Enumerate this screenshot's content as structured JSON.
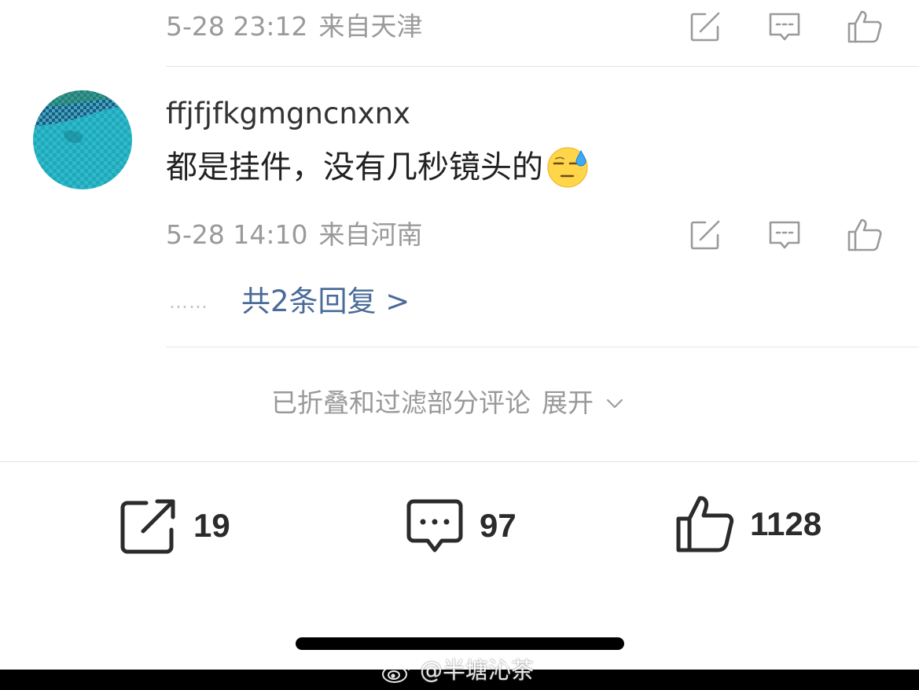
{
  "previous_comment": {
    "date": "5-28 23:12",
    "location": "来自天津"
  },
  "comment": {
    "username": "ffjfjfkgmgncnxnx",
    "text": "都是挂件，没有几秒镜头的",
    "emoji": "sweat-smile-emoji",
    "date": "5-28 14:10",
    "location": "来自河南",
    "reply_dots": "……",
    "replies_link": "共2条回复 >"
  },
  "collapsed_notice": {
    "text": "已折叠和过滤部分评论",
    "expand_label": "展开"
  },
  "bottom_bar": {
    "repost_count": "19",
    "comment_count": "97",
    "like_count": "1128"
  },
  "watermark": {
    "text": "@半塘沁茶"
  },
  "icons": {
    "repost": "repost-icon",
    "comment": "comment-icon",
    "like": "thumbs-up-icon",
    "expand": "chevron-down-icon",
    "watermark_logo": "weibo-logo-icon"
  },
  "colors": {
    "link": "#4a6a99",
    "meta": "#9a9a9a",
    "icon": "#9a9a9a",
    "bar_icon": "#2b2b2b"
  }
}
